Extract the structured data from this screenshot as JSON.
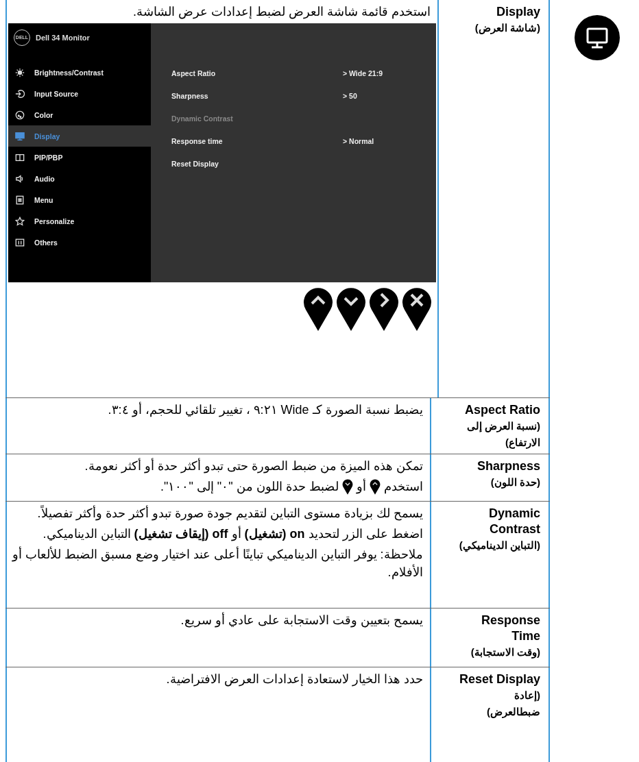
{
  "rows": [
    {
      "name": "Display",
      "name_ar": "(شاشة العرض)",
      "paragraphs": [
        {
          "kind": "text",
          "text": "استخدم قائمة شاشة العرض لضبط إعدادات عرض الشاشة."
        }
      ],
      "osd": {
        "logo": "DELL",
        "title": "Dell 34 Monitor",
        "menu": [
          {
            "label": "Brightness/Contrast",
            "kind": "brightness",
            "selected": false
          },
          {
            "label": "Input Source",
            "kind": "input",
            "selected": false
          },
          {
            "label": "Color",
            "kind": "color",
            "selected": false
          },
          {
            "label": "Display",
            "kind": "display",
            "selected": true
          },
          {
            "label": "PIP/PBP",
            "kind": "pip",
            "selected": false
          },
          {
            "label": "Audio",
            "kind": "audio",
            "selected": false
          },
          {
            "label": "Menu",
            "kind": "menu",
            "selected": false
          },
          {
            "label": "Personalize",
            "kind": "star",
            "selected": false
          },
          {
            "label": "Others",
            "kind": "others",
            "selected": false
          }
        ],
        "settings": [
          {
            "label": "Aspect Ratio",
            "value": "> Wide 21:9",
            "disabled": false
          },
          {
            "label": "Sharpness",
            "value": "> 50",
            "disabled": false
          },
          {
            "label": "Dynamic Contrast",
            "disabled": true
          },
          {
            "label": "Response time",
            "value": "> Normal",
            "disabled": false
          },
          {
            "label": "Reset Display",
            "disabled": false
          }
        ],
        "buttons": [
          {
            "kind": "up"
          },
          {
            "kind": "down"
          },
          {
            "kind": "right"
          },
          {
            "kind": "close"
          }
        ]
      }
    },
    {
      "name": "Aspect Ratio",
      "name_ar": "(نسبة العرض إلى الارتفاع)",
      "paragraphs": [
        {
          "kind": "text",
          "text": "يضبط نسبة الصورة كـ Wide ٩:٢١ ، تغيير تلقائي للحجم، أو ٣:٤."
        }
      ]
    },
    {
      "name": "Sharpness",
      "name_ar": "(حدة اللون)",
      "paragraphs": [
        {
          "kind": "text",
          "text": "تمكن هذه الميزة من ضبط الصورة حتى تبدو أكثر حدة أو أكثر نعومة."
        },
        {
          "kind": "with_icons",
          "parts": [
            {
              "kind": "text",
              "text": "استخدم"
            },
            {
              "kind": "up"
            },
            {
              "kind": "text",
              "text": "أو"
            },
            {
              "kind": "down"
            },
            {
              "kind": "text",
              "text": "لضبط حدة اللون من \"٠\" إلى \"١٠٠\"."
            }
          ]
        }
      ]
    },
    {
      "name": "Dynamic Contrast",
      "name_ar": "(التباين الديناميكي)",
      "paragraphs": [
        {
          "kind": "text",
          "text": "يسمح لك بزيادة مستوى التباين لتقديم جودة صورة تبدو أكثر حدة وأكثر تفصيلاً."
        },
        {
          "kind": "text",
          "text": "اضغط على الزر لتحديد **on** **(تشغيل)** أو **off** **(إيقاف تشغيل)** التباين الديناميكي."
        },
        {
          "kind": "text",
          "text": "ملاحظة: يوفر التباين الديناميكي تباينًا أعلى عند اختيار وضع مسبق الضبط للألعاب أو الأفلام."
        }
      ]
    },
    {
      "name": "Response Time",
      "name_ar": "(وقت الاستجابة)",
      "paragraphs": [
        {
          "kind": "text",
          "text": "يسمح بتعيين وقت الاستجابة على عادي أو سريع."
        }
      ]
    },
    {
      "name": "Reset Display",
      "name_ar": "(إعادة ضبطالعرض)",
      "paragraphs": [
        {
          "kind": "text",
          "text": "حدد هذا الخيار لاستعادة إعدادات العرض الافتراضية."
        }
      ]
    }
  ]
}
